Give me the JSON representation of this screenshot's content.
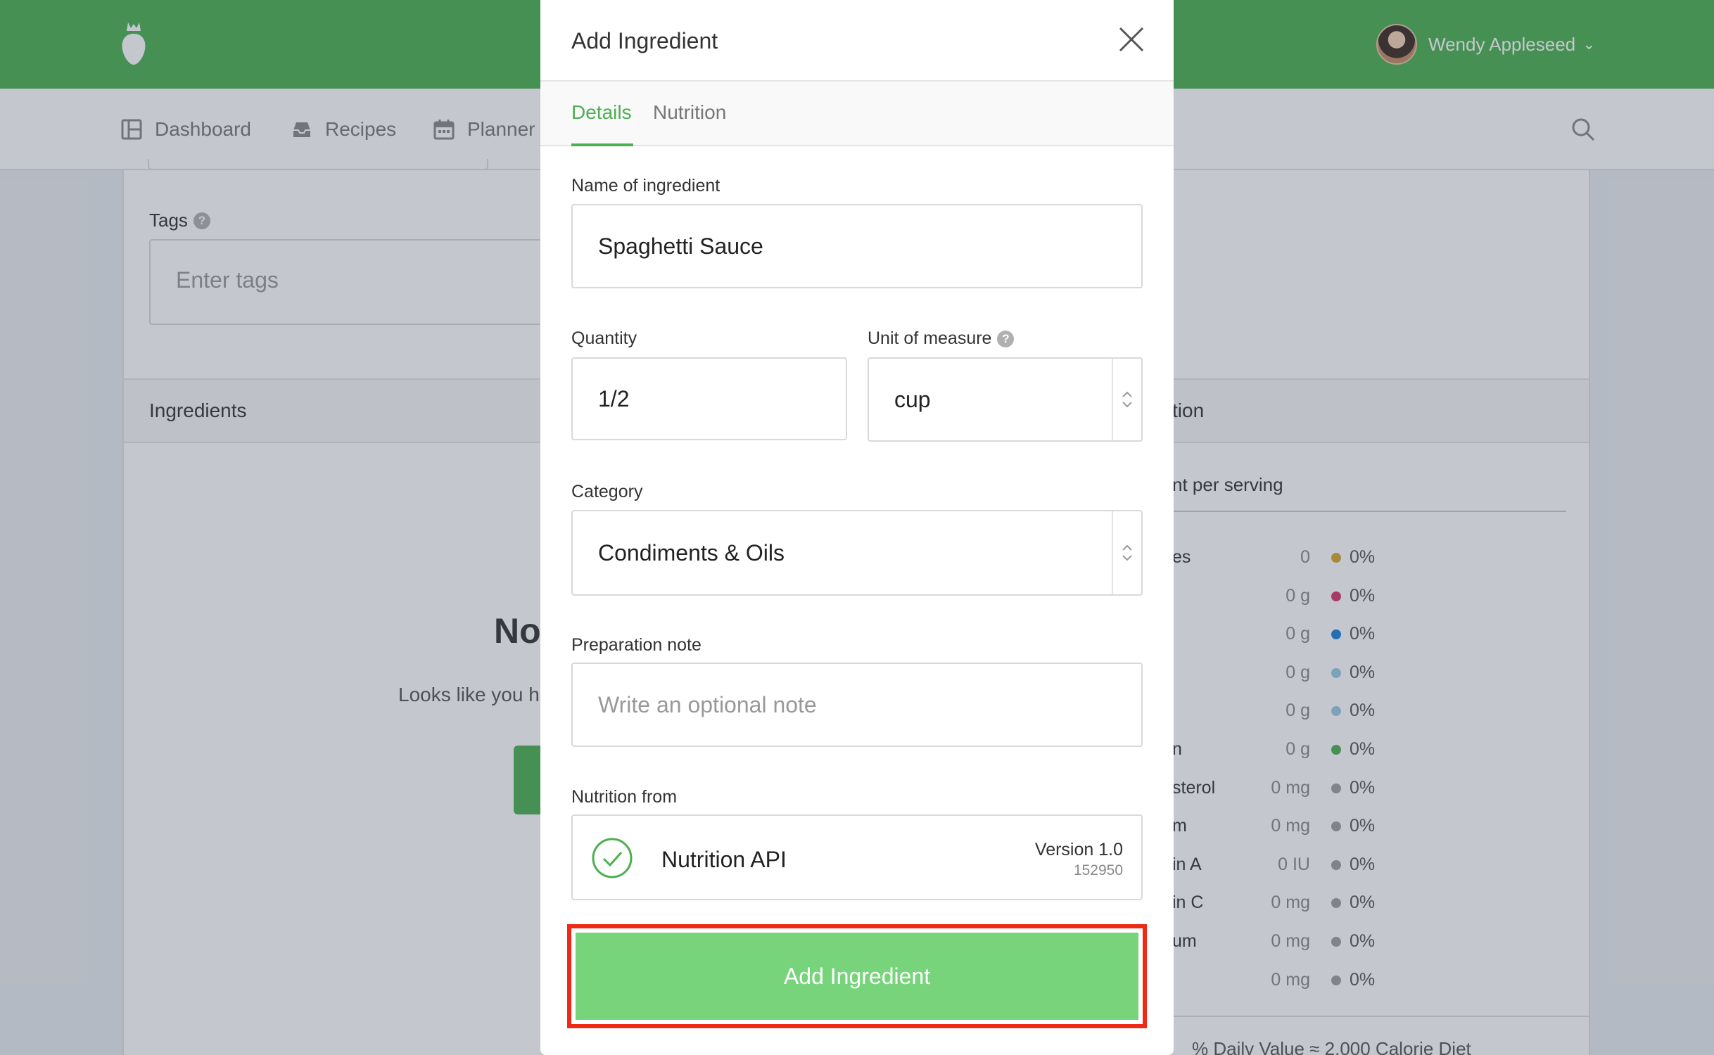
{
  "header": {
    "user_name": "Wendy Appleseed",
    "user_caret": "⌄"
  },
  "nav": {
    "items": [
      {
        "label": "Dashboard",
        "icon": "dashboard-icon"
      },
      {
        "label": "Recipes",
        "icon": "inbox-icon"
      },
      {
        "label": "Planner",
        "icon": "calendar-icon"
      }
    ],
    "search_icon": "search-icon"
  },
  "recipe_form": {
    "tags_label": "Tags",
    "tags_placeholder": "Enter tags",
    "help_glyph": "?"
  },
  "ingredients_section": {
    "header": "Ingredients",
    "empty_title": "No",
    "empty_text": "Looks like you ha"
  },
  "nutrition_panel": {
    "header_visible": "tion",
    "per_serving_visible": "nt per serving",
    "rows": [
      {
        "name": "es",
        "amount": "0",
        "pct": "0%",
        "color": "#d4a72c"
      },
      {
        "name": "",
        "amount": "0 g",
        "pct": "0%",
        "color": "#d6336c"
      },
      {
        "name": "",
        "amount": "0 g",
        "pct": "0%",
        "color": "#1c7ed6"
      },
      {
        "name": "",
        "amount": "0 g",
        "pct": "0%",
        "color": "#99c9e3"
      },
      {
        "name": "",
        "amount": "0 g",
        "pct": "0%",
        "color": "#99c9e3"
      },
      {
        "name": "n",
        "amount": "0 g",
        "pct": "0%",
        "color": "#4caf50"
      },
      {
        "name": "sterol",
        "amount": "0 mg",
        "pct": "0%",
        "color": "#9e9e9e"
      },
      {
        "name": "m",
        "amount": "0 mg",
        "pct": "0%",
        "color": "#9e9e9e"
      },
      {
        "name": "in A",
        "amount": "0 IU",
        "pct": "0%",
        "color": "#9e9e9e"
      },
      {
        "name": "in C",
        "amount": "0 mg",
        "pct": "0%",
        "color": "#9e9e9e"
      },
      {
        "name": "um",
        "amount": "0 mg",
        "pct": "0%",
        "color": "#9e9e9e"
      },
      {
        "name": "",
        "amount": "0 mg",
        "pct": "0%",
        "color": "#9e9e9e"
      }
    ],
    "footer_visible": "% Daily Value ≈ 2,000 Calorie Diet"
  },
  "modal": {
    "title": "Add Ingredient",
    "close_icon": "close-icon",
    "tabs": [
      {
        "label": "Details",
        "active": true
      },
      {
        "label": "Nutrition",
        "active": false
      }
    ],
    "fields": {
      "name_label": "Name of ingredient",
      "name_value": "Spaghetti Sauce",
      "quantity_label": "Quantity",
      "quantity_value": "1/2",
      "unit_label": "Unit of measure",
      "unit_value": "cup",
      "category_label": "Category",
      "category_value": "Condiments & Oils",
      "note_label": "Preparation note",
      "note_placeholder": "Write an optional note",
      "source_label": "Nutrition from"
    },
    "source": {
      "name": "Nutrition API",
      "version": "Version 1.0",
      "id": "152950",
      "icon": "check-circle-icon"
    },
    "submit_label": "Add Ingredient",
    "colors": {
      "accent": "#4caf50",
      "submit_bg": "#77d47a",
      "highlight": "#ee2a16"
    }
  }
}
